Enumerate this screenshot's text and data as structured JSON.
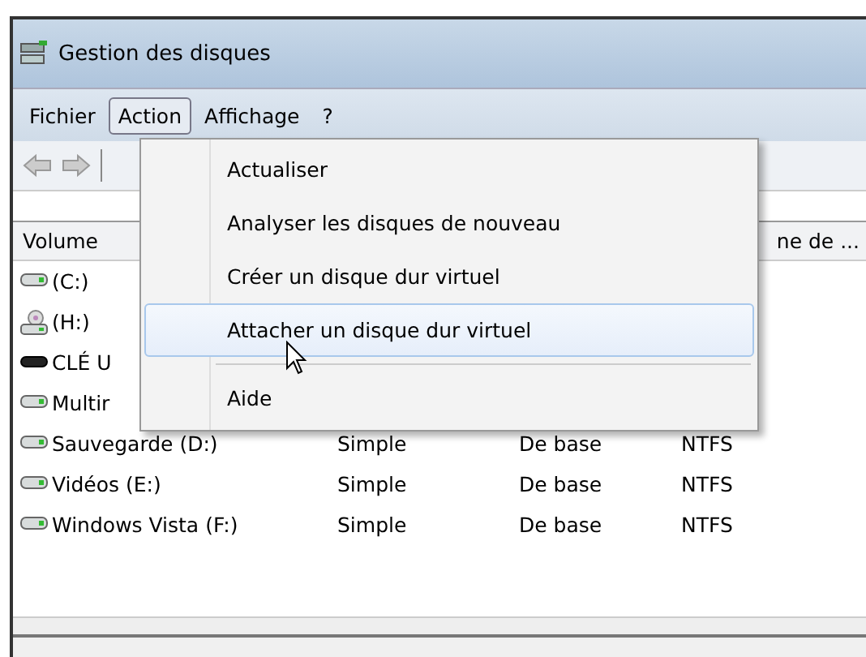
{
  "window": {
    "title": "Gestion des disques"
  },
  "menu_bar": [
    {
      "label": "Fichier",
      "selected": false
    },
    {
      "label": "Action",
      "selected": true
    },
    {
      "label": "Affichage",
      "selected": false
    },
    {
      "label": "?",
      "selected": false
    }
  ],
  "table": {
    "columns": [
      {
        "label": "Volume"
      },
      {
        "label": "ne de ..."
      }
    ],
    "rows": [
      {
        "kind": "hdd",
        "cells": [
          "(C:)"
        ]
      },
      {
        "kind": "optical",
        "cells": [
          "(H:)"
        ]
      },
      {
        "kind": "usb",
        "cells": [
          "CLÉ U"
        ]
      },
      {
        "kind": "hdd",
        "cells": [
          "Multir"
        ]
      },
      {
        "kind": "hdd",
        "cells": [
          "Sauvegarde (D:)",
          "Simple",
          "De base",
          "NTFS"
        ]
      },
      {
        "kind": "hdd",
        "cells": [
          "Vidéos (E:)",
          "Simple",
          "De base",
          "NTFS"
        ]
      },
      {
        "kind": "hdd",
        "cells": [
          "Windows Vista (F:)",
          "Simple",
          "De base",
          "NTFS"
        ]
      }
    ]
  },
  "dropdown_menu": [
    {
      "kind": "item",
      "label": "Actualiser",
      "selected": false
    },
    {
      "kind": "item",
      "label": "Analyser les disques de nouveau",
      "selected": false
    },
    {
      "kind": "item",
      "label": "Créer un disque dur virtuel",
      "selected": false
    },
    {
      "kind": "item",
      "label": "Attacher un disque dur virtuel",
      "selected": true
    },
    {
      "kind": "separator"
    },
    {
      "kind": "item",
      "label": "Aide",
      "selected": false
    }
  ]
}
